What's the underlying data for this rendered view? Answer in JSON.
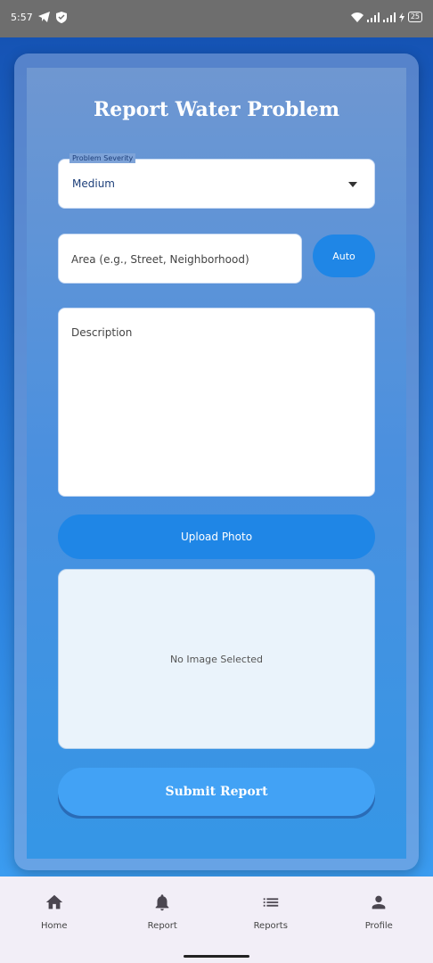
{
  "status_bar": {
    "time": "5:57",
    "battery": "25"
  },
  "form": {
    "title": "Report Water Problem",
    "severity_label": "Problem Severity",
    "severity_value": "Medium",
    "area_placeholder": "Area (e.g., Street, Neighborhood)",
    "auto_label": "Auto",
    "description_placeholder": "Description",
    "upload_label": "Upload Photo",
    "no_image": "No Image Selected",
    "submit_label": "Submit Report"
  },
  "nav": [
    {
      "label": "Home",
      "icon": "home-icon"
    },
    {
      "label": "Report",
      "icon": "bell-icon"
    },
    {
      "label": "Reports",
      "icon": "list-icon"
    },
    {
      "label": "Profile",
      "icon": "person-icon"
    }
  ],
  "colors": {
    "accent": "#1f86e6",
    "submit": "#42a2f5",
    "nav_bg": "#f2eef7"
  }
}
